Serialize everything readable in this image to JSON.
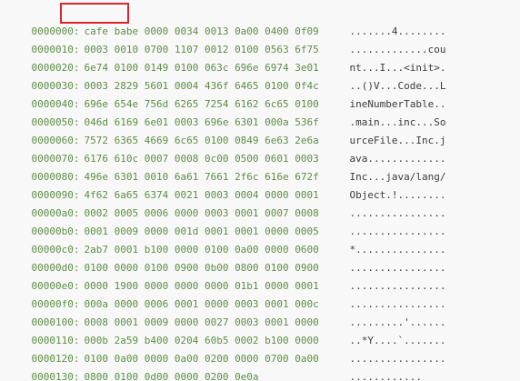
{
  "highlight_label": "cafe babe",
  "rows": [
    {
      "addr": "0000000:",
      "hex": "cafe babe 0000 0034 0013 0a00 0400 0f09",
      "ascii": ".......4........"
    },
    {
      "addr": "0000010:",
      "hex": "0003 0010 0700 1107 0012 0100 0563 6f75",
      "ascii": ".............cou"
    },
    {
      "addr": "0000020:",
      "hex": "6e74 0100 0149 0100 063c 696e 6974 3e01",
      "ascii": "nt...I...<init>."
    },
    {
      "addr": "0000030:",
      "hex": "0003 2829 5601 0004 436f 6465 0100 0f4c",
      "ascii": "..()V...Code...L"
    },
    {
      "addr": "0000040:",
      "hex": "696e 654e 756d 6265 7254 6162 6c65 0100",
      "ascii": "ineNumberTable.."
    },
    {
      "addr": "0000050:",
      "hex": "046d 6169 6e01 0003 696e 6301 000a 536f",
      "ascii": ".main...inc...So"
    },
    {
      "addr": "0000060:",
      "hex": "7572 6365 4669 6c65 0100 0849 6e63 2e6a",
      "ascii": "urceFile...Inc.j"
    },
    {
      "addr": "0000070:",
      "hex": "6176 610c 0007 0008 0c00 0500 0601 0003",
      "ascii": "ava............."
    },
    {
      "addr": "0000080:",
      "hex": "496e 6301 0010 6a61 7661 2f6c 616e 672f",
      "ascii": "Inc...java/lang/"
    },
    {
      "addr": "0000090:",
      "hex": "4f62 6a65 6374 0021 0003 0004 0000 0001",
      "ascii": "Object.!........"
    },
    {
      "addr": "00000a0:",
      "hex": "0002 0005 0006 0000 0003 0001 0007 0008",
      "ascii": "................"
    },
    {
      "addr": "00000b0:",
      "hex": "0001 0009 0000 001d 0001 0001 0000 0005",
      "ascii": "................"
    },
    {
      "addr": "00000c0:",
      "hex": "2ab7 0001 b100 0000 0100 0a00 0000 0600",
      "ascii": "*..............."
    },
    {
      "addr": "00000d0:",
      "hex": "0100 0000 0100 0900 0b00 0800 0100 0900",
      "ascii": "................"
    },
    {
      "addr": "00000e0:",
      "hex": "0000 1900 0000 0000 0000 01b1 0000 0001",
      "ascii": "................"
    },
    {
      "addr": "00000f0:",
      "hex": "000a 0000 0006 0001 0000 0003 0001 000c",
      "ascii": "................"
    },
    {
      "addr": "0000100:",
      "hex": "0008 0001 0009 0000 0027 0003 0001 0000",
      "ascii": ".........'......"
    },
    {
      "addr": "0000110:",
      "hex": "000b 2a59 b400 0204 60b5 0002 b100 0000",
      "ascii": "..*Y....`......."
    },
    {
      "addr": "0000120:",
      "hex": "0100 0a00 0000 0a00 0200 0000 0700 0a00",
      "ascii": "................"
    },
    {
      "addr": "0000130:",
      "hex": "0800 0100 0d00 0000 0200 0e0a",
      "ascii": "............"
    }
  ]
}
